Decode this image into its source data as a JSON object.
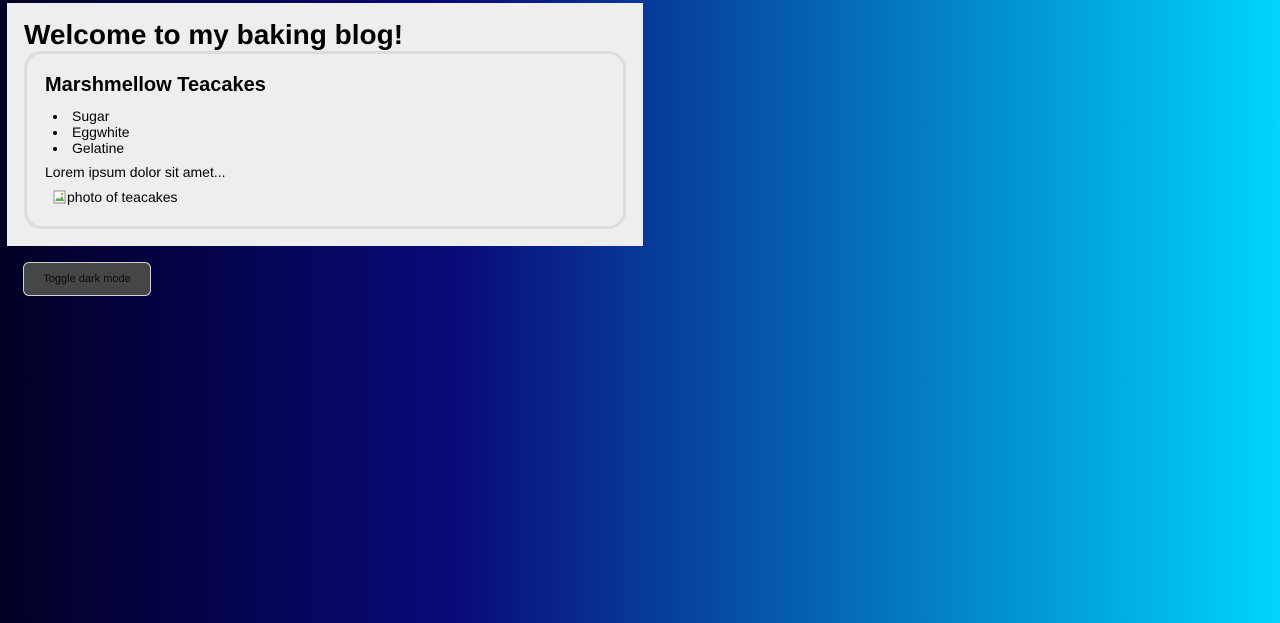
{
  "blog": {
    "title": "Welcome to my baking blog!"
  },
  "post": {
    "title": "Marshmellow Teacakes",
    "ingredients": [
      "Sugar",
      "Eggwhite",
      "Gelatine"
    ],
    "text": "Lorem ipsum dolor sit amet...",
    "image_alt": "photo of teacakes",
    "image_icon": "broken-image-icon"
  },
  "controls": {
    "toggle_label": "Toggle dark mode"
  },
  "colors": {
    "gradient": [
      "#020024",
      "#090979",
      "#00d4ff"
    ],
    "panel_bg": "#eeeeee",
    "card_border": "#dcdcdc",
    "button_bg": "#464646"
  }
}
